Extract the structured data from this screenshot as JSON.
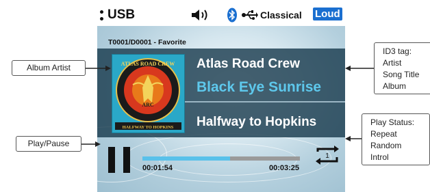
{
  "status_bar": {
    "source_label": "USB",
    "mode_label": "Classical",
    "loud_label": "Loud",
    "icons": [
      "volume-icon",
      "bluetooth-icon",
      "usb-icon"
    ]
  },
  "track_info": "T0001/D0001 - Favorite",
  "now_playing": {
    "artist": "Atlas Road Crew",
    "song_title": "Black Eye Sunrise",
    "album": "Halfway to Hopkins",
    "cover_top_text": "ATLAS ROAD CREW",
    "cover_center_text": "ARC",
    "cover_bottom_text": "HALFWAY TO HOPKINS"
  },
  "playback": {
    "elapsed": "00:01:54",
    "total": "00:03:25",
    "progress_fraction": 0.556,
    "repeat_count": "1"
  },
  "callouts": {
    "album_artist": "Album Artist",
    "play_pause": "Play/Pause",
    "id3": [
      "ID3 tag:",
      "Artist",
      "Song Title",
      "Album"
    ],
    "play_status": [
      "Play Status:",
      "Repeat",
      "Random",
      "Introl"
    ]
  },
  "colors": {
    "loud_bg": "#1a6fd0",
    "song_title": "#5ec8ec",
    "progress_fill": "#59c1ea",
    "progress_track": "#9a9a9a"
  }
}
